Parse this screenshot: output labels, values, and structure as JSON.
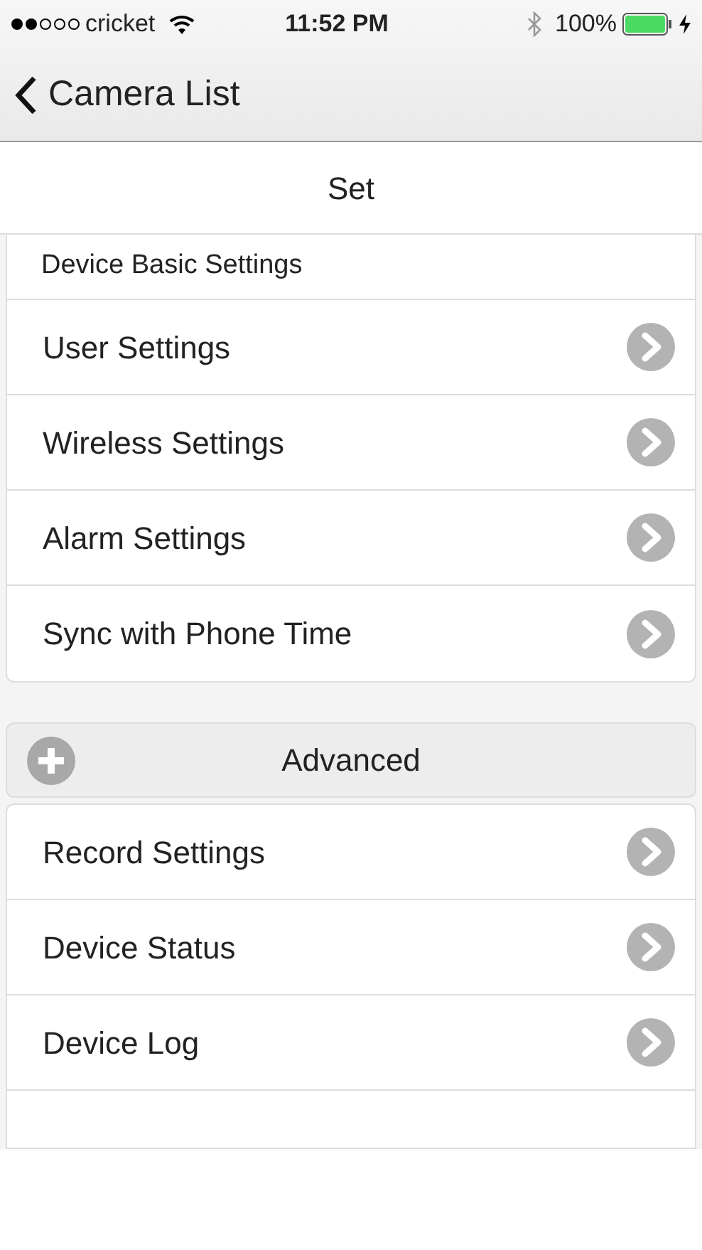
{
  "status_bar": {
    "carrier": "cricket",
    "time": "11:52 PM",
    "battery": "100%",
    "charging": true
  },
  "nav": {
    "back_label": "Camera List"
  },
  "title": "Set",
  "basic_section": {
    "header": "Device Basic Settings",
    "items": [
      {
        "label": "User Settings"
      },
      {
        "label": "Wireless Settings"
      },
      {
        "label": "Alarm Settings"
      },
      {
        "label": "Sync with Phone Time"
      }
    ]
  },
  "advanced_section": {
    "header": "Advanced",
    "expanded": true,
    "items": [
      {
        "label": "Record Settings"
      },
      {
        "label": "Device Status"
      },
      {
        "label": "Device Log"
      }
    ]
  }
}
